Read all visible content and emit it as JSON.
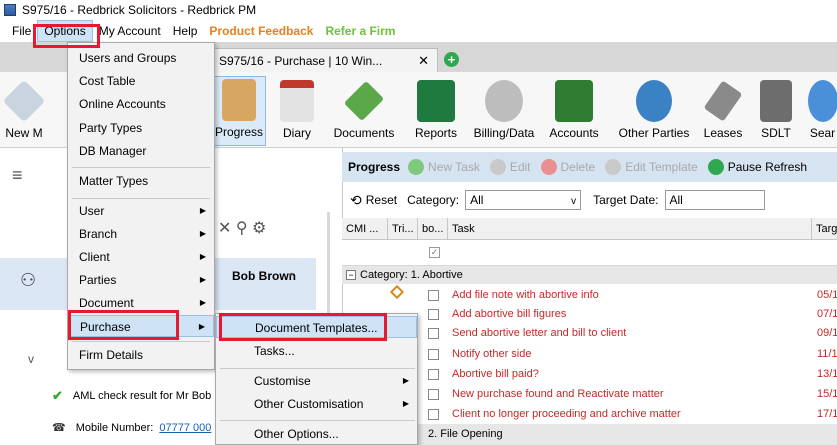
{
  "window": {
    "title": "S975/16 - Redbrick Solicitors - Redbrick PM"
  },
  "menubar": {
    "items": [
      {
        "label": "File",
        "name": "menu-file"
      },
      {
        "label": "Options",
        "name": "menu-options"
      },
      {
        "label": "My Account",
        "name": "menu-my-account"
      },
      {
        "label": "Help",
        "name": "menu-help"
      },
      {
        "label": "Product Feedback",
        "name": "menu-product-feedback"
      },
      {
        "label": "Refer a Firm",
        "name": "menu-refer-a-firm"
      }
    ]
  },
  "tab": {
    "label": "S975/16 - Purchase | 10 Win...",
    "close": "✕",
    "add": "+"
  },
  "ribbon": {
    "buttons": [
      {
        "label": "New M",
        "icon": "new-matter-icon",
        "color": "#c9d4de"
      },
      {
        "label": "Progress",
        "icon": "clipboard-icon",
        "color": "#d7a761"
      },
      {
        "label": "Diary",
        "icon": "calendar-icon",
        "color": "#e3e3e3"
      },
      {
        "label": "Documents",
        "icon": "documents-arrow-icon",
        "color": "#5aa84a"
      },
      {
        "label": "Reports",
        "icon": "excel-icon",
        "color": "#1f7a3f"
      },
      {
        "label": "Billing/Data",
        "icon": "bill-icon",
        "color": "#9b9b9b"
      },
      {
        "label": "Accounts",
        "icon": "bi-icon",
        "color": "#2e7d32"
      },
      {
        "label": "Other Parties",
        "icon": "people-icon",
        "color": "#3b82c4"
      },
      {
        "label": "Leases",
        "icon": "calculator-icon",
        "color": "#8a8a8a"
      },
      {
        "label": "SDLT",
        "icon": "house-icon",
        "color": "#6d6d6d"
      },
      {
        "label": "Sear",
        "icon": "search-globe-icon",
        "color": "#4a90d9"
      }
    ]
  },
  "options_menu": {
    "items": [
      {
        "label": "Users and Groups",
        "submenu": false
      },
      {
        "label": "Cost Table",
        "submenu": false
      },
      {
        "label": "Online Accounts",
        "submenu": false
      },
      {
        "label": "Party Types",
        "submenu": false
      },
      {
        "label": "DB Manager",
        "submenu": false
      },
      {
        "label": "Matter Types",
        "submenu": false
      },
      {
        "label": "User",
        "submenu": true
      },
      {
        "label": "Branch",
        "submenu": true
      },
      {
        "label": "Client",
        "submenu": true
      },
      {
        "label": "Parties",
        "submenu": true
      },
      {
        "label": "Document",
        "submenu": true
      },
      {
        "label": "Purchase",
        "submenu": true
      },
      {
        "label": "Firm Details",
        "submenu": false
      }
    ]
  },
  "purchase_submenu": {
    "items": [
      {
        "label": "Document Templates...",
        "submenu": false
      },
      {
        "label": "Tasks...",
        "submenu": false
      },
      {
        "label": "Customise",
        "submenu": true
      },
      {
        "label": "Other Customisation",
        "submenu": true
      },
      {
        "label": "Other Options...",
        "submenu": false
      }
    ]
  },
  "left_panel": {
    "client_name": "Bob Brown",
    "aml_text": "AML check result for Mr Bob",
    "mobile_label": "Mobile Number:",
    "mobile_value": "07777 000"
  },
  "progress_toolbar": {
    "title": "Progress",
    "buttons": [
      "New Task",
      "Edit",
      "Delete",
      "Edit Template",
      "Pause Refresh"
    ]
  },
  "filter": {
    "reset": "Reset",
    "category_label": "Category:",
    "category_value": "All",
    "target_label": "Target Date:",
    "target_value": "All"
  },
  "grid": {
    "columns": [
      "CMI ...",
      "Tri...",
      "bo...",
      "Task",
      "Targ"
    ],
    "category1": "Category: 1. Abortive",
    "rows": [
      {
        "task": "Add file note with abortive info",
        "date": "05/1"
      },
      {
        "task": "Add abortive bill figures",
        "date": "07/1"
      },
      {
        "task": "Send abortive letter and bill to client",
        "date": "09/1"
      },
      {
        "task": "Notify other side",
        "date": "11/1"
      },
      {
        "task": "Abortive bill paid?",
        "date": "13/1"
      },
      {
        "task": "New purchase found and Reactivate matter",
        "date": "15/1"
      },
      {
        "task": "Client no longer proceeding and archive matter",
        "date": "17/1"
      }
    ],
    "category2": "2. File Opening"
  },
  "colors": {
    "highlight": "#cfe3f7",
    "annotation_red": "#e8192c",
    "task_red": "#c62828",
    "toolbar_bg": "#d6e4f2"
  }
}
